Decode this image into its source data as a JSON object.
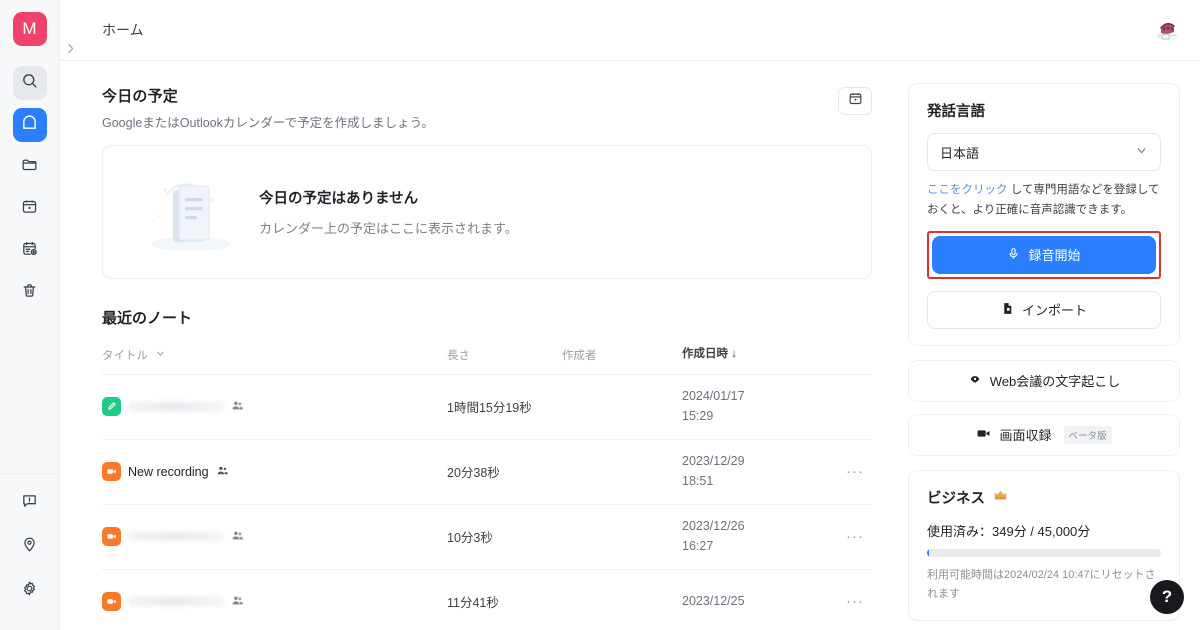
{
  "rail": {
    "logo_label": "M",
    "items": [
      {
        "name": "search-icon",
        "label": "検索"
      },
      {
        "name": "home-icon",
        "label": "ホーム"
      },
      {
        "name": "folder-icon",
        "label": "フォルダ"
      },
      {
        "name": "calendar-icon",
        "label": "カレンダー"
      },
      {
        "name": "calendar-plus-icon",
        "label": "予定を追加"
      },
      {
        "name": "trash-icon",
        "label": "ゴミ箱"
      }
    ],
    "bottom_items": [
      {
        "name": "feedback-icon",
        "label": "フィードバック"
      },
      {
        "name": "pin-icon",
        "label": "ピン"
      },
      {
        "name": "gear-icon",
        "label": "設定"
      }
    ]
  },
  "topbar": {
    "breadcrumb": "ホーム",
    "avatar_name": "user-avatar"
  },
  "today": {
    "title": "今日の予定",
    "subtitle": "GoogleまたはOutlookカレンダーで予定を作成しましょう。",
    "calendar_button_icon": "calendar-icon",
    "empty_title": "今日の予定はありません",
    "empty_subtitle": "カレンダー上の予定はここに表示されます。"
  },
  "notes": {
    "heading": "最近のノート",
    "columns": {
      "title": "タイトル",
      "length": "長さ",
      "author": "作成者",
      "created": "作成日時"
    },
    "sort_column": "作成日時",
    "sort_direction": "↓",
    "rows": [
      {
        "icon": "note-icon",
        "icon_color": "green",
        "title": "",
        "title_redacted": true,
        "shared": true,
        "length": "1時間15分19秒",
        "author": "",
        "author_redacted": true,
        "date": "2024/01/17",
        "time": "15:29",
        "menu": "···"
      },
      {
        "icon": "video-icon",
        "icon_color": "orange",
        "title": "New recording",
        "title_redacted": false,
        "shared": true,
        "length": "20分38秒",
        "author": "",
        "author_redacted": false,
        "date": "2023/12/29",
        "time": "18:51",
        "menu": "···"
      },
      {
        "icon": "video-icon",
        "icon_color": "orange",
        "title": "",
        "title_redacted": true,
        "shared": true,
        "length": "10分3秒",
        "author": "",
        "author_redacted": false,
        "date": "2023/12/26",
        "time": "16:27",
        "menu": "···"
      },
      {
        "icon": "video-icon",
        "icon_color": "orange",
        "title": "",
        "title_redacted": true,
        "shared": true,
        "length": "11分41秒",
        "author": "",
        "author_redacted": false,
        "date": "2023/12/25",
        "time": "",
        "menu": "···"
      }
    ]
  },
  "language_card": {
    "title": "発話言語",
    "selected": "日本語",
    "chevron": "⌄",
    "hint_link": "ここをクリック",
    "hint_rest": " して専門用語などを登録しておくと、より正確に音声認識できます。"
  },
  "actions": {
    "record": "録音開始",
    "record_icon": "microphone-icon",
    "import": "インポート",
    "import_icon": "import-file-icon",
    "web_meeting": "Web会議の文字起こし",
    "web_meeting_icon": "meeting-icon",
    "screen_record": "画面収録",
    "screen_record_icon": "video-camera-icon",
    "screen_record_badge": "ベータ版",
    "highlight_color": "#e03131"
  },
  "business": {
    "title": "ビジネス",
    "badge_icon": "crown-icon",
    "usage_text": "使用済み：349分 / 45,000分",
    "used_minutes": 349,
    "total_minutes": 45000,
    "progress_percent": 0.8,
    "reset_text": "利用可能時間は2024/02/24 10:47にリセットされます"
  },
  "help": {
    "label": "?"
  },
  "colors": {
    "accent": "#2b7fff",
    "logo": "#f0436b",
    "highlight": "#e03131",
    "note_green": "#1ecb8b",
    "note_orange": "#f97a29"
  }
}
